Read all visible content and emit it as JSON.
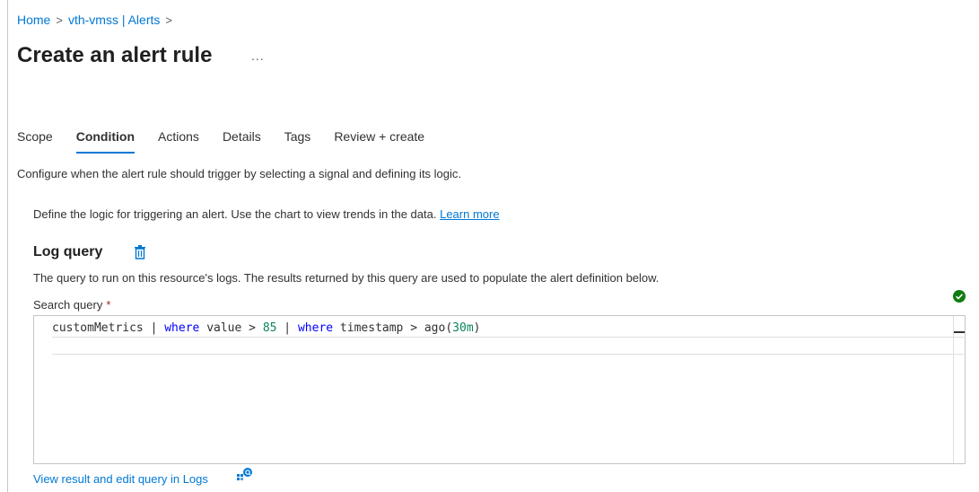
{
  "breadcrumb": {
    "items": [
      "Home",
      "vth-vmss | Alerts"
    ],
    "separator": ">"
  },
  "page": {
    "title": "Create an alert rule",
    "more_label": "..."
  },
  "tabs": [
    {
      "label": "Scope",
      "active": false
    },
    {
      "label": "Condition",
      "active": true
    },
    {
      "label": "Actions",
      "active": false
    },
    {
      "label": "Details",
      "active": false
    },
    {
      "label": "Tags",
      "active": false
    },
    {
      "label": "Review + create",
      "active": false
    }
  ],
  "condition": {
    "intro": "Configure when the alert rule should trigger by selecting a signal and defining its logic.",
    "logic_text": "Define the logic for triggering an alert. Use the chart to view trends in the data.",
    "learn_more": "Learn more",
    "section_title": "Log query",
    "section_desc": "The query to run on this resource's logs. The results returned by this query are used to populate the alert definition below.",
    "search_label": "Search query",
    "required_mark": "*",
    "query": {
      "t1": "customMetrics | ",
      "kw1": "where",
      "t2": " value > ",
      "n1": "85",
      "t3": " | ",
      "kw2": "where",
      "t4": " timestamp > ago(",
      "n2": "30m",
      "t5": ")"
    },
    "view_logs_link": "View result and edit query in Logs"
  },
  "colors": {
    "accent": "#0078d4",
    "success": "#107c10",
    "required": "#a4262c",
    "keyword": "#0000ff",
    "number": "#098658"
  },
  "icons": {
    "delete": "trash-icon",
    "valid": "check-circle-icon",
    "logs": "logs-icon",
    "more": "ellipsis-icon"
  }
}
